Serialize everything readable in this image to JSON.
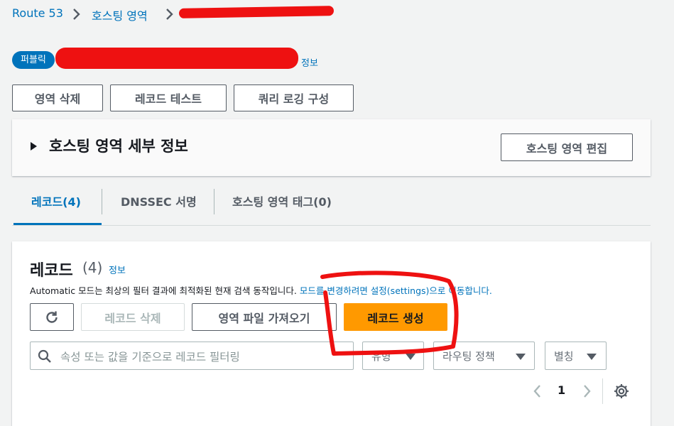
{
  "breadcrumb": {
    "root": "Route 53",
    "hosted_zones": "호스팅 영역"
  },
  "zone_header": {
    "visibility_badge": "퍼블릭",
    "info_label": "정보"
  },
  "zone_actions": {
    "delete_zone": "영역 삭제",
    "test_record": "레코드 테스트",
    "configure_query_logging": "쿼리 로깅 구성"
  },
  "details_panel": {
    "title": "호스팅 영역 세부 정보",
    "edit_button": "호스팅 영역 편집"
  },
  "tabs": [
    {
      "label": "레코드(4)",
      "active": true
    },
    {
      "label": "DNSSEC 서명",
      "active": false
    },
    {
      "label": "호스팅 영역 태그(0)",
      "active": false
    }
  ],
  "records": {
    "title": "레코드",
    "count": "(4)",
    "info_label": "정보",
    "description_prefix": "Automatic 모드는 최상의 필터 결과에 최적화된 현재 검색 동작입니다.",
    "description_link": "모드를 변경하려면 설정(settings)으로 이동합니다.",
    "delete_button": "레코드 삭제",
    "import_zone_file_button": "영역 파일 가져오기",
    "create_record_button": "레코드 생성",
    "search_placeholder": "속성 또는 값을 기준으로 레코드 필터링",
    "filters": [
      "유형",
      "라우팅 정책",
      "별칭"
    ],
    "pagination": {
      "current_page": "1"
    }
  },
  "colors": {
    "link": "#0073bb",
    "primary": "#ff9900",
    "annotation": "#ee1111"
  }
}
